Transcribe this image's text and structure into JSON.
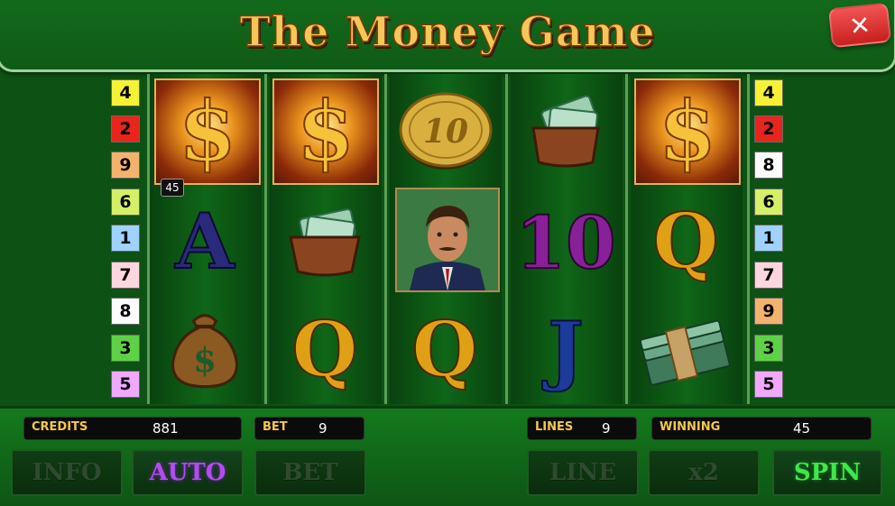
{
  "game": {
    "title": "The Money Game",
    "close_label": "✕"
  },
  "lines": {
    "left": [
      {
        "n": "4",
        "color": "#f6f134"
      },
      {
        "n": "2",
        "color": "#e8251c"
      },
      {
        "n": "9",
        "color": "#f4b36c"
      },
      {
        "n": "6",
        "color": "#d6ef68"
      },
      {
        "n": "1",
        "color": "#9fd2ff"
      },
      {
        "n": "7",
        "color": "#ffd6de"
      },
      {
        "n": "8",
        "color": "#fbfbfb"
      },
      {
        "n": "3",
        "color": "#5fd147"
      },
      {
        "n": "5",
        "color": "#f1a8ff"
      }
    ],
    "right": [
      {
        "n": "4",
        "color": "#f6f134"
      },
      {
        "n": "2",
        "color": "#e8251c"
      },
      {
        "n": "8",
        "color": "#fbfbfb"
      },
      {
        "n": "6",
        "color": "#d6ef68"
      },
      {
        "n": "1",
        "color": "#9fd2ff"
      },
      {
        "n": "7",
        "color": "#ffd6de"
      },
      {
        "n": "9",
        "color": "#f4b36c"
      },
      {
        "n": "3",
        "color": "#5fd147"
      },
      {
        "n": "5",
        "color": "#f1a8ff"
      }
    ]
  },
  "reels": {
    "symbols": [
      [
        "dollar-sign",
        "letter-a",
        "money-bag"
      ],
      [
        "dollar-sign",
        "wallet",
        "letter-q"
      ],
      [
        "coin-10",
        "businessman",
        "letter-q"
      ],
      [
        "wallet",
        "number-10",
        "letter-j"
      ],
      [
        "dollar-sign",
        "letter-q",
        "cash-stack"
      ]
    ],
    "coin_label": "10",
    "ten_label": "10",
    "a_label": "A",
    "q_label": "Q",
    "j_label": "J",
    "win_badge": "45"
  },
  "panel": {
    "credits_label": "CREDITS",
    "credits_value": "881",
    "bet_label": "BET",
    "bet_value": "9",
    "lines_label": "LINES",
    "lines_value": "9",
    "winning_label": "WINNING",
    "winning_value": "45"
  },
  "buttons": {
    "info": "INFO",
    "auto": "AUTO",
    "bet": "BET",
    "line": "LINE",
    "x2": "x2",
    "spin": "SPIN"
  }
}
